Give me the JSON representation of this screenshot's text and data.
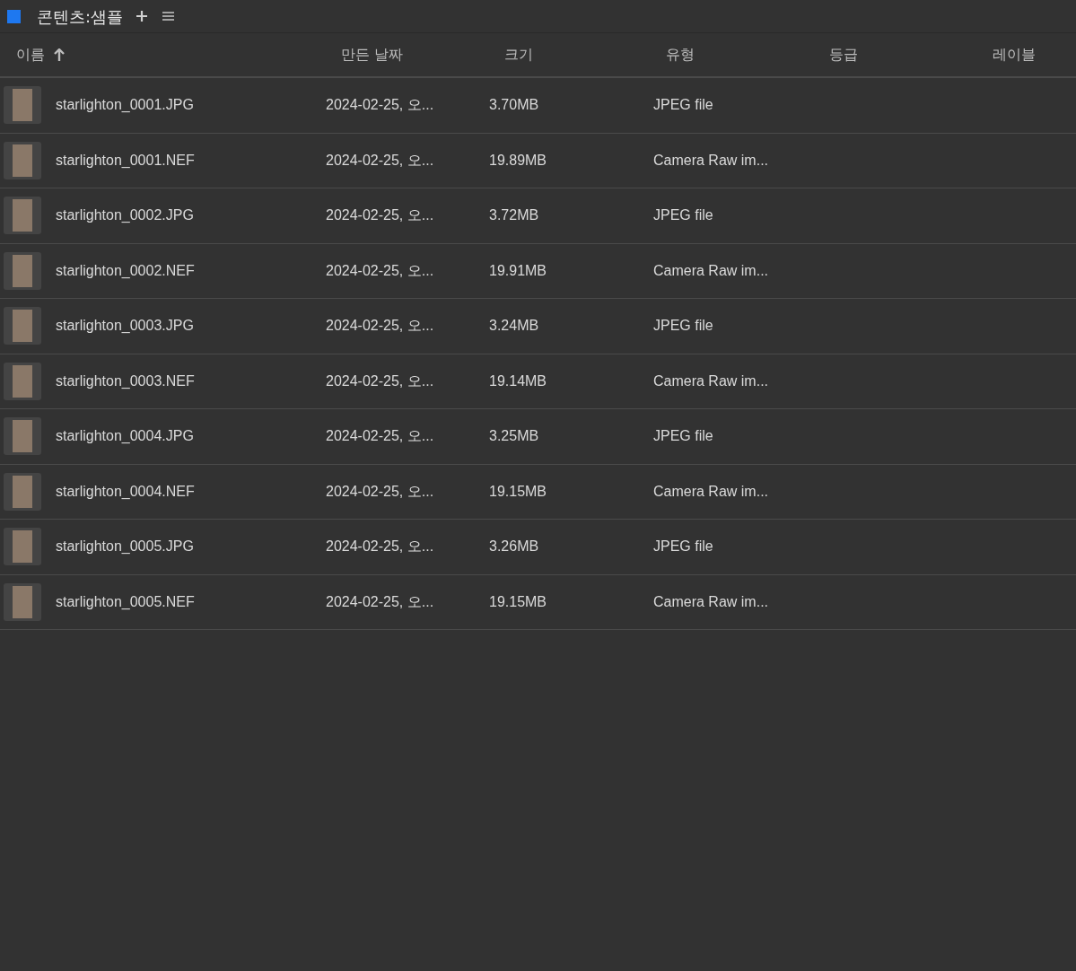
{
  "panel": {
    "title": "콘텐츠:샘플"
  },
  "columns": [
    {
      "label": "이름",
      "sorted": true
    },
    {
      "label": "만든 날짜",
      "sorted": false
    },
    {
      "label": "크기",
      "sorted": false
    },
    {
      "label": "유형",
      "sorted": false
    },
    {
      "label": "등급",
      "sorted": false
    },
    {
      "label": "레이블",
      "sorted": false
    }
  ],
  "rows": [
    {
      "name": "starlighton_0001.JPG",
      "created": "2024-02-25, 오...",
      "size": "3.70MB",
      "type": "JPEG file"
    },
    {
      "name": "starlighton_0001.NEF",
      "created": "2024-02-25, 오...",
      "size": "19.89MB",
      "type": "Camera Raw im..."
    },
    {
      "name": "starlighton_0002.JPG",
      "created": "2024-02-25, 오...",
      "size": "3.72MB",
      "type": "JPEG file"
    },
    {
      "name": "starlighton_0002.NEF",
      "created": "2024-02-25, 오...",
      "size": "19.91MB",
      "type": "Camera Raw im..."
    },
    {
      "name": "starlighton_0003.JPG",
      "created": "2024-02-25, 오...",
      "size": "3.24MB",
      "type": "JPEG file"
    },
    {
      "name": "starlighton_0003.NEF",
      "created": "2024-02-25, 오...",
      "size": "19.14MB",
      "type": "Camera Raw im..."
    },
    {
      "name": "starlighton_0004.JPG",
      "created": "2024-02-25, 오...",
      "size": "3.25MB",
      "type": "JPEG file"
    },
    {
      "name": "starlighton_0004.NEF",
      "created": "2024-02-25, 오...",
      "size": "19.15MB",
      "type": "Camera Raw im..."
    },
    {
      "name": "starlighton_0005.JPG",
      "created": "2024-02-25, 오...",
      "size": "3.26MB",
      "type": "JPEG file"
    },
    {
      "name": "starlighton_0005.NEF",
      "created": "2024-02-25, 오...",
      "size": "19.15MB",
      "type": "Camera Raw im..."
    }
  ]
}
